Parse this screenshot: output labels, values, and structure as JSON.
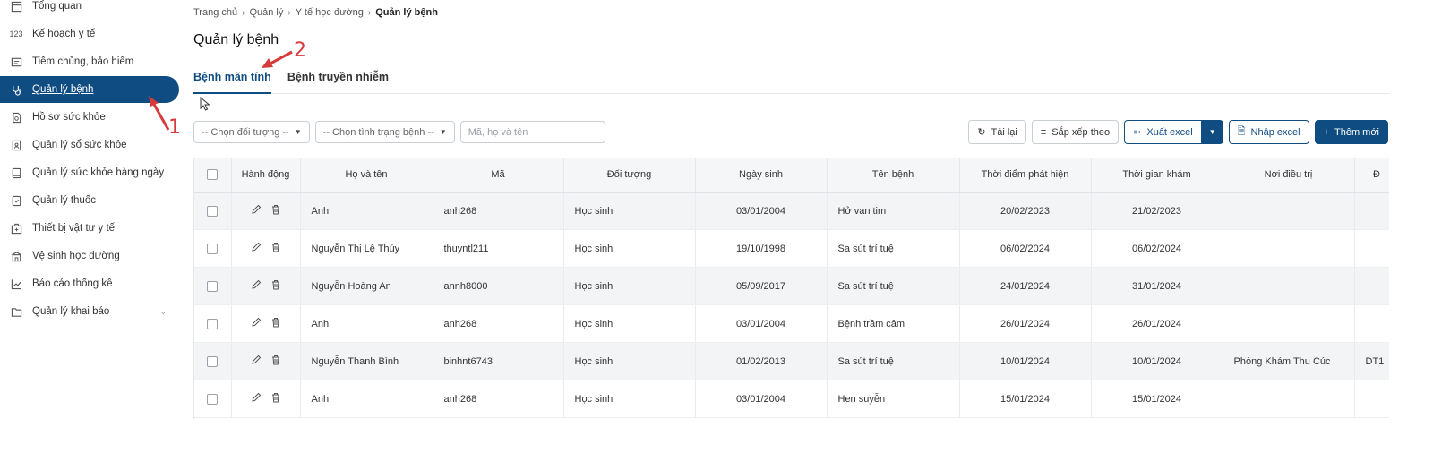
{
  "sidebar": {
    "items": [
      {
        "label": "Tổng quan",
        "icon": "dashboard-icon"
      },
      {
        "label": "Kế hoạch y tế",
        "icon": "numbers-icon",
        "icon_text": "123"
      },
      {
        "label": "Tiêm chủng, bảo hiểm",
        "icon": "id-card-icon"
      },
      {
        "label": "Quản lý bệnh",
        "icon": "stethoscope-icon",
        "active": true
      },
      {
        "label": "Hồ sơ sức khỏe",
        "icon": "file-icon"
      },
      {
        "label": "Quản lý sổ sức khỏe",
        "icon": "contact-book-icon"
      },
      {
        "label": "Quản lý sức khỏe hàng ngày",
        "icon": "tablet-icon"
      },
      {
        "label": "Quản lý thuốc",
        "icon": "pill-icon"
      },
      {
        "label": "Thiết bị vật tư y tế",
        "icon": "medical-kit-icon"
      },
      {
        "label": "Vệ sinh học đường",
        "icon": "school-icon"
      },
      {
        "label": "Báo cáo thống kê",
        "icon": "line-chart-icon"
      },
      {
        "label": "Quản lý khai báo",
        "icon": "folder-icon"
      }
    ]
  },
  "breadcrumb": {
    "items": [
      "Trang chủ",
      "Quản lý",
      "Y tế học đường"
    ],
    "current": "Quản lý bệnh"
  },
  "page": {
    "title": "Quản lý bệnh"
  },
  "tabs": [
    "Bệnh mãn tính",
    "Bệnh truyền nhiễm"
  ],
  "filters": {
    "object_select": "-- Chọn đối tượng --",
    "status_select": "-- Chọn tình trạng bệnh --",
    "search_placeholder": "Mã, họ và tên"
  },
  "actions": {
    "reload": "Tải lại",
    "sort": "Sắp xếp theo",
    "export": "Xuất excel",
    "import": "Nhập excel",
    "add": "Thêm mới"
  },
  "table": {
    "columns": [
      "Hành động",
      "Họ và tên",
      "Mã",
      "Đối tượng",
      "Ngày sinh",
      "Tên bệnh",
      "Thời điểm phát hiện",
      "Thời gian khám",
      "Nơi điều trị",
      "Đ"
    ],
    "rows": [
      {
        "name": "Anh",
        "code": "anh268",
        "object": "Học sinh",
        "dob": "03/01/2004",
        "disease": "Hở van tim",
        "detected": "20/02/2023",
        "exam": "21/02/2023",
        "place": "",
        "extra": ""
      },
      {
        "name": "Nguyễn Thị Lệ Thúy",
        "code": "thuyntl211",
        "object": "Học sinh",
        "dob": "19/10/1998",
        "disease": "Sa sút trí tuệ",
        "detected": "06/02/2024",
        "exam": "06/02/2024",
        "place": "",
        "extra": ""
      },
      {
        "name": "Nguyễn Hoàng An",
        "code": "annh8000",
        "object": "Học sinh",
        "dob": "05/09/2017",
        "disease": "Sa sút trí tuệ",
        "detected": "24/01/2024",
        "exam": "31/01/2024",
        "place": "",
        "extra": ""
      },
      {
        "name": "Anh",
        "code": "anh268",
        "object": "Học sinh",
        "dob": "03/01/2004",
        "disease": "Bệnh trầm cảm",
        "detected": "26/01/2024",
        "exam": "26/01/2024",
        "place": "",
        "extra": ""
      },
      {
        "name": "Nguyễn Thanh Bình",
        "code": "binhnt6743",
        "object": "Học sinh",
        "dob": "01/02/2013",
        "disease": "Sa sút trí tuệ",
        "detected": "10/01/2024",
        "exam": "10/01/2024",
        "place": "Phòng Khám Thu Cúc",
        "extra": "DT1"
      },
      {
        "name": "Anh",
        "code": "anh268",
        "object": "Học sinh",
        "dob": "03/01/2004",
        "disease": "Hen suyễn",
        "detected": "15/01/2024",
        "exam": "15/01/2024",
        "place": "",
        "extra": ""
      }
    ]
  },
  "annotations": [
    "1",
    "2"
  ],
  "colors": {
    "primary": "#0f4c81",
    "annotation": "#d63a3a"
  }
}
